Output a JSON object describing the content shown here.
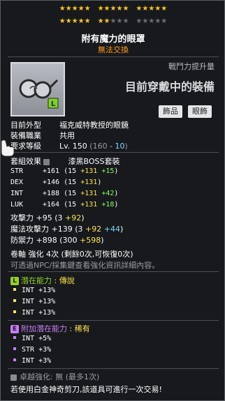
{
  "stars": {
    "row1_filled": 15,
    "row2_filled": 5,
    "row2_partial": 2
  },
  "title": "附有魔力的眼罩",
  "subtitle": "無法交換",
  "power": {
    "label": "戰鬥力提升量",
    "value": "目前穿戴中的裝備"
  },
  "tags": [
    "飾品",
    "眼飾"
  ],
  "info": [
    {
      "label": "目前外型",
      "value": "福克威特教授的眼鏡"
    },
    {
      "label": "裝備職業",
      "value": "共用"
    },
    {
      "label": "要求等級",
      "value": "Lv. 150",
      "extra_open": "(160",
      "extra_minus": "- 10",
      "extra_close": ")"
    }
  ],
  "set": {
    "label": "套組效果",
    "value": "漆黑BOSS套裝"
  },
  "stats": [
    {
      "name": "STR",
      "total": "+161",
      "base": "(15",
      "bonus1": "+131",
      "bonus2": "+15",
      "close": ")"
    },
    {
      "name": "DEX",
      "total": "+146",
      "base": "(15",
      "bonus1": "+131",
      "bonus2": "",
      "close": ")"
    },
    {
      "name": "INT",
      "total": "+188",
      "base": "(15",
      "bonus1": "+131",
      "bonus2": "+42",
      "close": ")"
    },
    {
      "name": "LUK",
      "total": "+164",
      "base": "(15",
      "bonus1": "+131",
      "bonus2": "+18",
      "close": ")"
    }
  ],
  "attack": {
    "label": "攻擊力",
    "total": "+95",
    "base": "(3",
    "bonus1": "+92",
    "close": ")"
  },
  "magic": {
    "label": "魔法攻擊力",
    "total": "+139",
    "base": "(3",
    "bonus1": "+92",
    "bonus2": "+44",
    "close": ")"
  },
  "defense": {
    "label": "防禦力",
    "total": "+898",
    "base": "(300",
    "bonus1": "+598",
    "close": ")"
  },
  "scroll": "卷軸 強化 4次 (剩餘0次,可恢復0次)",
  "hint": "可透過NPC/採集鍵查看強化資訊詳細內容。",
  "potential": {
    "badge": "L",
    "label": "潛在能力",
    "grade": ": 傳說",
    "lines": [
      "INT +13%",
      "INT +13%",
      "INT +13%"
    ]
  },
  "bonus_potential": {
    "badge": "E",
    "label": "附加潛在能力",
    "grade": ": 稀有",
    "lines": [
      "INT +5%",
      "STR +3%",
      "INT +3%"
    ]
  },
  "excellence": "卓越強化: 無 (最多1次)",
  "footer": "若使用白金神奇剪刀,該道具可進行一次交易!",
  "colors": {
    "legend": "#93d02a",
    "rare": "#c580f0",
    "yellow": "#ffe34a",
    "green": "#7fff62",
    "cyan": "#7fdcff",
    "orange": "#ff9a1e"
  }
}
